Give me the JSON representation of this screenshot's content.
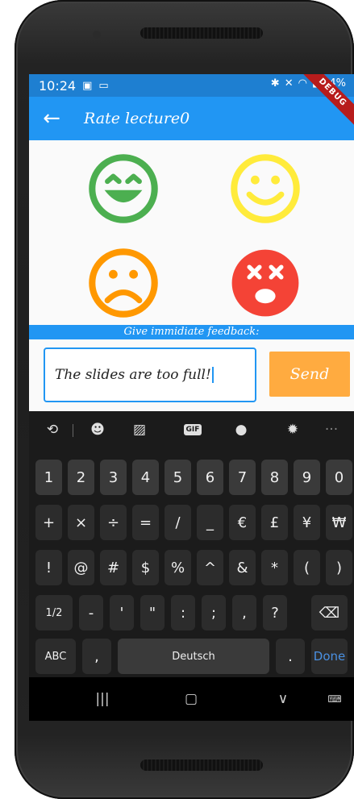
{
  "status_bar": {
    "time": "10:24",
    "left_icons": [
      "image-icon",
      "cast-icon"
    ],
    "right_icons": [
      "bluetooth-icon",
      "mute-icon",
      "wifi-icon",
      "signal-icon"
    ],
    "battery": "64%",
    "debug_label": "DEBUG"
  },
  "app_bar": {
    "title": "Rate lecture0"
  },
  "faces": [
    {
      "name": "very-happy",
      "color": "#4caf50"
    },
    {
      "name": "happy",
      "color": "#ffeb3b"
    },
    {
      "name": "sad",
      "color": "#ff9800"
    },
    {
      "name": "very-sad",
      "color": "#f44336"
    }
  ],
  "feedback": {
    "label": "Give immidiate feedback:",
    "input_value": "The slides are too full!",
    "send_label": "Send"
  },
  "keyboard": {
    "toolbar": [
      "translate-icon",
      "emoji-icon",
      "sticker-icon",
      "GIF",
      "microphone-icon",
      "settings-icon",
      "more-icon"
    ],
    "row1": [
      "1",
      "2",
      "3",
      "4",
      "5",
      "6",
      "7",
      "8",
      "9",
      "0"
    ],
    "row2": [
      "+",
      "×",
      "÷",
      "=",
      "/",
      "_",
      "€",
      "£",
      "¥",
      "₩"
    ],
    "row3": [
      "!",
      "@",
      "#",
      "$",
      "%",
      "^",
      "&",
      "*",
      "(",
      ")"
    ],
    "row4": [
      "1/2",
      "-",
      "'",
      "\"",
      ":",
      ";",
      ",",
      "?"
    ],
    "row5": {
      "abc": "ABC",
      "comma": ",",
      "space": "Deutsch",
      "period": ".",
      "done": "Done"
    }
  },
  "nav_bar": {
    "buttons": [
      "recents-icon",
      "home-icon",
      "back-chevron-icon",
      "keyboard-icon"
    ]
  },
  "colors": {
    "primary": "#2196f3",
    "status_bar": "#1e7fd1",
    "send": "#ffab40",
    "keyboard_bg": "#1b1b1b"
  }
}
